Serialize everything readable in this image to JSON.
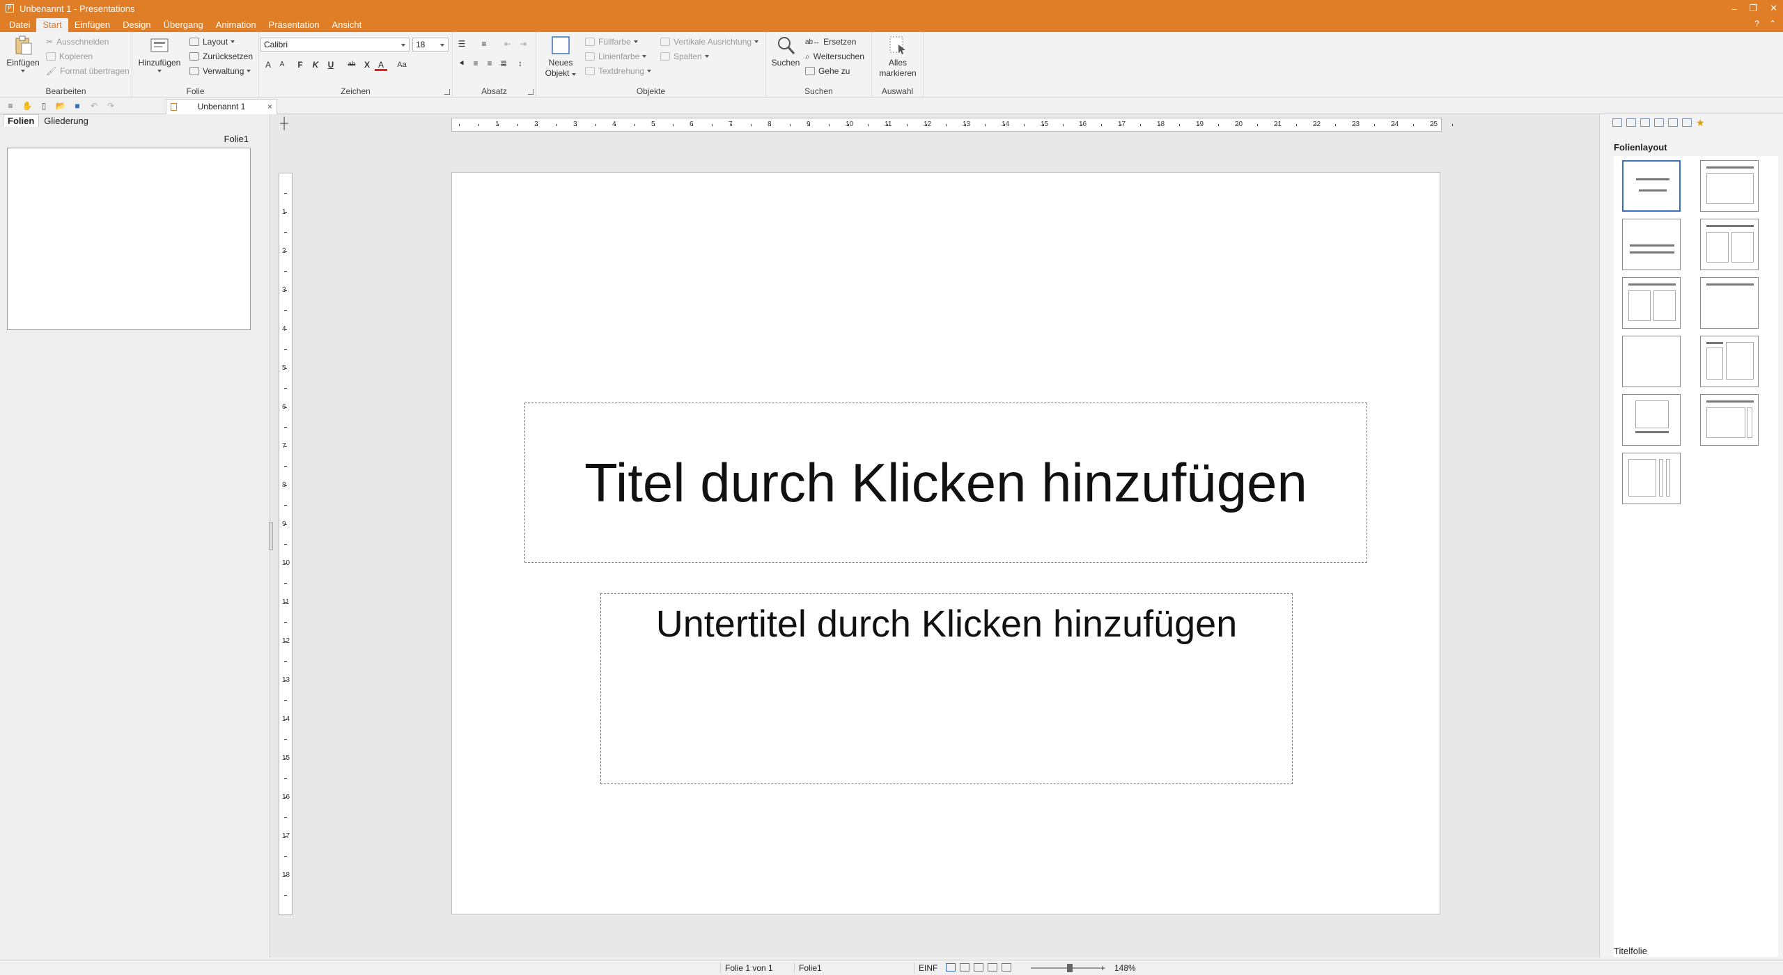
{
  "window": {
    "title": "Unbenannt 1 - Presentations",
    "controls": [
      "–",
      "❐",
      "✕"
    ]
  },
  "menubar": {
    "items": [
      "Datei",
      "Start",
      "Einfügen",
      "Design",
      "Übergang",
      "Animation",
      "Präsentation",
      "Ansicht"
    ],
    "active": "Start",
    "right": [
      "?",
      "⌃"
    ]
  },
  "ribbon": {
    "bearbeiten": {
      "label": "Bearbeiten",
      "paste": "Einfügen",
      "cut": "Ausschneiden",
      "copy": "Kopieren",
      "format": "Format übertragen"
    },
    "folie": {
      "label": "Folie",
      "add": "Hinzufügen",
      "layout": "Layout",
      "reset": "Zurücksetzen",
      "manage": "Verwaltung"
    },
    "zeichen": {
      "label": "Zeichen",
      "font": "Calibri",
      "size": "18",
      "bold": "F",
      "italic": "K",
      "underline": "U",
      "strike": "ab",
      "cross": "X",
      "color": "A",
      "grow": "A",
      "shrink": "A",
      "case": "Aa"
    },
    "absatz": {
      "label": "Absatz"
    },
    "objekte": {
      "label": "Objekte",
      "new_object_1": "Neues",
      "new_object_2": "Objekt",
      "fill": "Füllfarbe",
      "line": "Linienfarbe",
      "text_rotation": "Textdrehung",
      "vertical_align": "Vertikale Ausrichtung",
      "columns": "Spalten"
    },
    "suchen": {
      "label": "Suchen",
      "search": "Suchen",
      "replace": "Ersetzen",
      "find_next": "Weitersuchen",
      "goto": "Gehe zu"
    },
    "auswahl": {
      "label": "Auswahl",
      "select_all_1": "Alles",
      "select_all_2": "markieren"
    }
  },
  "doc_tab": {
    "title": "Unbenannt 1",
    "close": "×"
  },
  "left_panel": {
    "tabs": [
      "Folien",
      "Gliederung"
    ],
    "active_tab": "Folien",
    "slide_name": "Folie1"
  },
  "ruler": {
    "h_numbers": [
      "1",
      "2",
      "3",
      "4",
      "5",
      "6",
      "7",
      "8",
      "9",
      "10",
      "11",
      "12",
      "13",
      "14",
      "15",
      "16",
      "17",
      "18",
      "19",
      "20",
      "21",
      "22",
      "23",
      "24",
      "25"
    ],
    "v_numbers": [
      "1",
      "2",
      "3",
      "4",
      "5",
      "6",
      "7",
      "8",
      "9",
      "10",
      "11",
      "12",
      "13",
      "14",
      "15",
      "16",
      "17",
      "18"
    ]
  },
  "slide": {
    "title_placeholder": "Titel durch Klicken hinzufügen",
    "subtitle_placeholder": "Untertitel durch Klicken hinzufügen"
  },
  "right_panel": {
    "title": "Folienlayout",
    "selected_layout": "Titelfolie",
    "layout_count": 11
  },
  "statusbar": {
    "slide_pos": "Folie 1 von 1",
    "slide_name": "Folie1",
    "mode": "EINF",
    "zoom": "148%"
  },
  "colors": {
    "accent": "#e07d27",
    "ribbon_bg": "#f3f3f3",
    "workspace": "#e8e8e8",
    "selection": "#3a6fc0"
  }
}
